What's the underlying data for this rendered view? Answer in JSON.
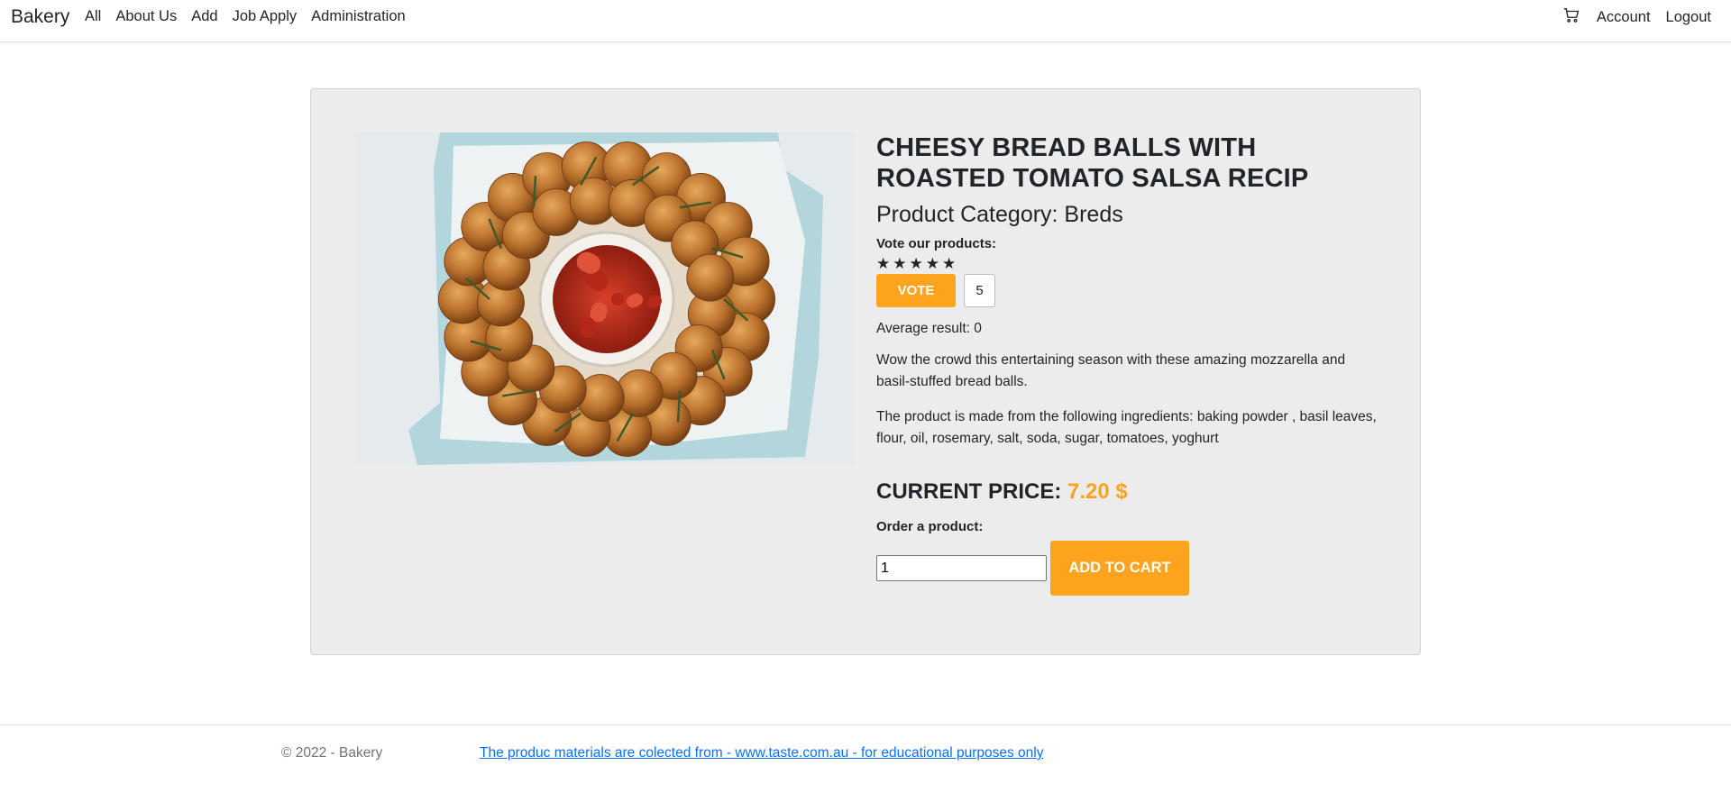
{
  "navbar": {
    "brand": "Bakery",
    "links": [
      "All",
      "About Us",
      "Add",
      "Job Apply",
      "Administration"
    ],
    "account": "Account",
    "logout": "Logout",
    "cart_icon": "cart-icon"
  },
  "product": {
    "title": "CHEESY BREAD BALLS WITH ROASTED TOMATO SALSA RECIP",
    "category": "Product Category: Breds",
    "vote_label": "Vote our products:",
    "stars": "★★★★★",
    "vote_button": "VOTE",
    "vote_value": "5",
    "average": "Average result: 0",
    "description": "Wow the crowd this entertaining season with these amazing mozzarella and basil-stuffed bread balls.",
    "ingredients": "The product is made from the following ingredients: baking powder , basil leaves, flour, oil, rosemary, salt, soda, sugar, tomatoes, yoghurt",
    "price_label": "CURRENT PRICE: ",
    "price_value": "7.20 $",
    "order_label": "Order a product:",
    "quantity": "1",
    "add_to_cart": "ADD TO CART"
  },
  "footer": {
    "copyright": "© 2022 - Bakery",
    "link": "The produc materials are colected from - www.taste.com.au - for educational purposes only"
  },
  "colors": {
    "accent": "#fea31d",
    "card_bg": "#ececec",
    "link": "#0d6efd"
  }
}
